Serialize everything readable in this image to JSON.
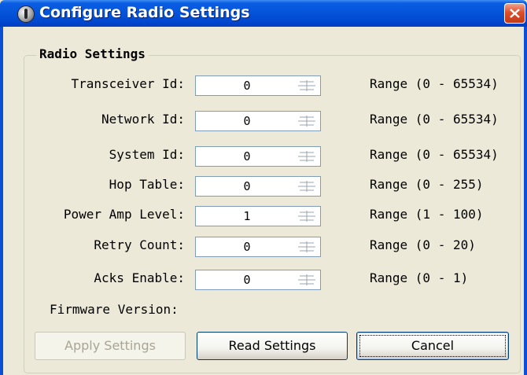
{
  "window": {
    "title": "Configure Radio Settings"
  },
  "group": {
    "legend": "Radio Settings"
  },
  "fields": [
    {
      "label": "Transceiver Id:",
      "value": "0",
      "range": "Range (0 - 65534)"
    },
    {
      "label": "Network Id:",
      "value": "0",
      "range": "Range (0 - 65534)"
    },
    {
      "label": "System Id:",
      "value": "0",
      "range": "Range (0 - 65534)"
    },
    {
      "label": "Hop Table:",
      "value": "0",
      "range": "Range (0 - 255)"
    },
    {
      "label": "Power Amp Level:",
      "value": "1",
      "range": "Range (1 - 100)"
    },
    {
      "label": "Retry Count:",
      "value": "0",
      "range": "Range (0 - 20)"
    },
    {
      "label": "Acks Enable:",
      "value": "0",
      "range": "Range (0 - 1)"
    }
  ],
  "firmware": {
    "label": "Firmware Version:"
  },
  "buttons": {
    "apply": "Apply Settings",
    "read": "Read Settings",
    "cancel": "Cancel"
  },
  "icons": {
    "app": "radio-icon",
    "close": "close-icon",
    "spin": "spin-arrows-icon"
  },
  "colors": {
    "titlebar": "#0453d8",
    "dialog_bg": "#ece9d8",
    "close_button": "#dd4f2b",
    "disabled_text": "#a8a596"
  }
}
